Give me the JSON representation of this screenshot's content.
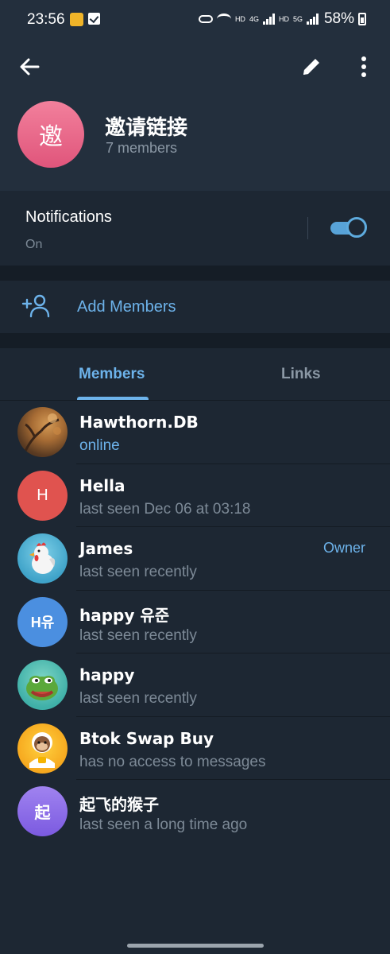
{
  "status_bar": {
    "time": "23:56",
    "battery": "58%",
    "hd1": "HD",
    "net1": "4G",
    "hd2": "HD",
    "net2": "5G"
  },
  "header": {
    "avatar_initial": "邀",
    "title": "邀请链接",
    "subtitle": "7 members",
    "avatar_colors": [
      "#f2809c",
      "#e0557b"
    ]
  },
  "notifications": {
    "label": "Notifications",
    "value": "On",
    "enabled": true
  },
  "add_members": {
    "label": "Add Members"
  },
  "tabs": [
    {
      "label": "Members",
      "active": true
    },
    {
      "label": "Links",
      "active": false
    }
  ],
  "members": [
    {
      "name": "Hawthorn.DB",
      "status": "online",
      "avatar": "photo-autumn-tree",
      "role": ""
    },
    {
      "name": "Hella",
      "status": "last seen Dec 06 at 03:18",
      "avatar": "H",
      "avatar_color": "#e0534f",
      "role": ""
    },
    {
      "name": "James",
      "status": "last seen recently",
      "avatar": "rooster-icon",
      "role": "Owner"
    },
    {
      "name": "happy 유준",
      "status": "last seen recently",
      "avatar": "H유",
      "avatar_color": "#4b8fe0",
      "role": ""
    },
    {
      "name": "happy",
      "status": "last seen recently",
      "avatar": "pepe-frog-icon",
      "role": ""
    },
    {
      "name": "Btok Swap Buy",
      "status": "has no access to messages",
      "avatar": "monkey-coin-icon",
      "role": ""
    },
    {
      "name": "起飞的猴子",
      "status": "last seen a long time ago",
      "avatar": "起",
      "avatar_color": "#8c6ee6",
      "role": ""
    }
  ],
  "colors": {
    "accent": "#6db3eb",
    "background": "#1d2733",
    "header_bg": "#232f3d",
    "secondary_text": "#7d8a97"
  }
}
